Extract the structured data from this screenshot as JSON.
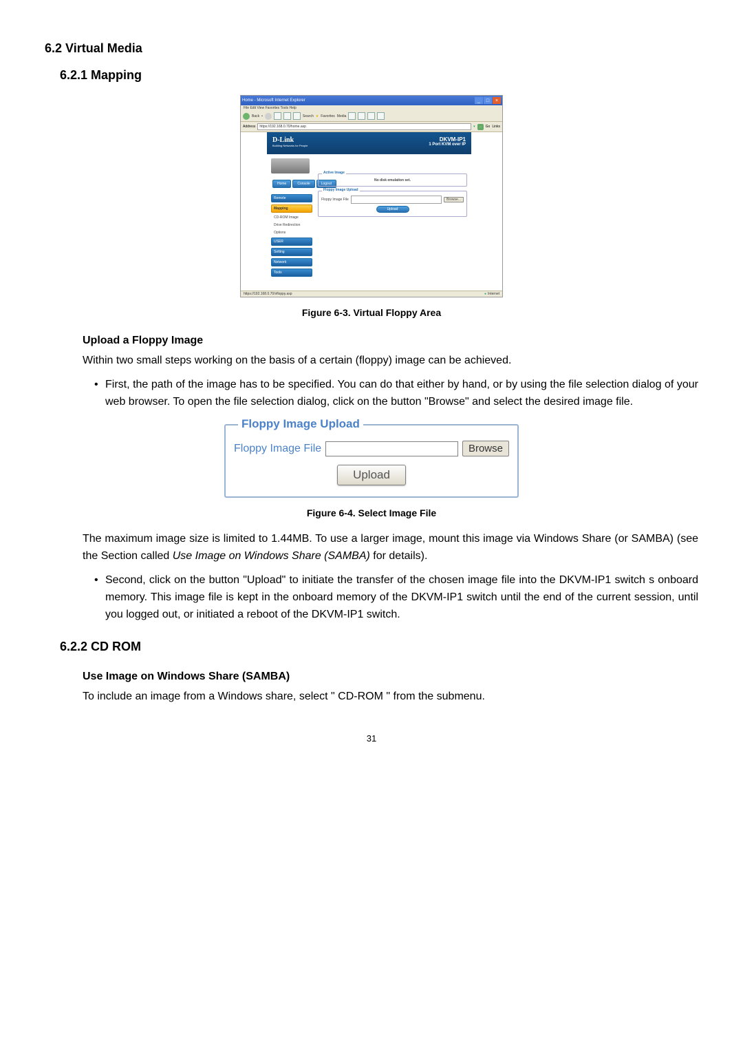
{
  "headings": {
    "h2": "6.2 Virtual Media",
    "h3_1": "6.2.1  Mapping",
    "h3_2": "6.2.2  CD ROM",
    "h4_upload": "Upload a Floppy Image",
    "h4_samba": "Use Image on Windows Share (SAMBA)"
  },
  "captions": {
    "fig63": "Figure 6-3. Virtual Floppy Area",
    "fig64": "Figure 6-4. Select Image File"
  },
  "paragraphs": {
    "p1": "Within two small steps working on the basis of a certain (floppy) image can be achieved.",
    "b1": "First, the path of the image has to be specified. You can do that either by hand, or by using the file selection dialog of your web browser. To open the file selection dialog, click on the button \"Browse\" and select the desired image file.",
    "p2a": "The maximum image size is limited to 1.44MB. To use a larger image, mount this image via Windows Share (or SAMBA) (see the Section called ",
    "p2_italic": "Use Image on Windows Share (SAMBA)",
    "p2b": " for details).",
    "b2": "Second, click on the button \"Upload\" to initiate the transfer of the chosen image file into the DKVM-IP1 switch s onboard memory. This image file is kept in the onboard memory of the DKVM-IP1 switch until the end of the current session, until you logged out, or initiated a reboot of the DKVM-IP1 switch.",
    "p3": "To include an image from a Windows share, select \" CD-ROM \" from the submenu."
  },
  "fig63": {
    "window_title": "Home - Microsoft Internet Explorer",
    "menubar": "File   Edit   View   Favorites   Tools   Help",
    "toolbar": {
      "back": "Back",
      "search": "Search",
      "favorites": "Favorites",
      "media": "Media"
    },
    "address_label": "Address",
    "address_value": "https://192.168.0.70/home.asp",
    "go": "Go",
    "links": "Links",
    "brand": "D-Link",
    "brand_sub": "Building Networks for People",
    "product": "DKVM-IP1",
    "product_sub": "1 Port KVM over IP",
    "tabs": {
      "home": "Home",
      "console": "Console",
      "logout": "Logout"
    },
    "sidebar": {
      "remote": "Remote",
      "mapping": "Mapping",
      "sub1": "CD-ROM Image",
      "sub2": "Drive Redirection",
      "sub3": "Options",
      "user": "USER",
      "setting": "Setting",
      "network": "Network",
      "tools": "Tools"
    },
    "fieldset1": {
      "legend": "Active Image",
      "msg": "No disk emulation set."
    },
    "fieldset2": {
      "legend": "Floppy Image Upload",
      "label": "Floppy Image File",
      "browse": "Browse...",
      "upload": "Upload"
    },
    "status_left": "https://192.168.0.70/vfloppy.asp",
    "status_right": "Internet"
  },
  "fig64": {
    "legend": "Floppy Image Upload",
    "label": "Floppy Image File",
    "browse": "Browse",
    "upload": "Upload"
  },
  "page_number": "31"
}
